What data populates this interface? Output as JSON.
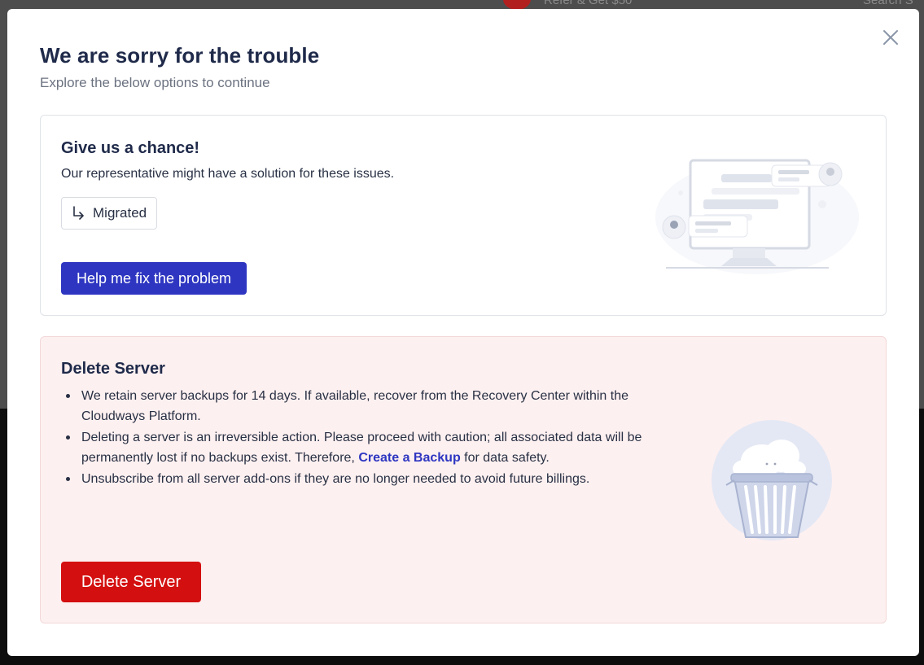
{
  "background": {
    "refer_text": "Refer & Get $50",
    "search_text": "Search S"
  },
  "modal": {
    "title": "We are sorry for the trouble",
    "subtitle": "Explore the below options to continue",
    "close_icon": "close-icon"
  },
  "chance_card": {
    "title": "Give us a chance!",
    "text": "Our representative might have a solution for these issues.",
    "chip_label": "Migrated",
    "chip_icon": "arrow-turn-down-right-icon",
    "help_button": "Help me fix the problem",
    "illustration": "support-chat-monitor-illustration"
  },
  "delete_card": {
    "title": "Delete Server",
    "bullets": {
      "b1": "We retain server backups for 14 days. If available, recover from the Recovery Center within the Cloudways Platform.",
      "b2_before": "Deleting a server is an irreversible action. Please proceed with caution; all associated data will be permanently lost if no backups exist. Therefore, ",
      "b2_link": "Create a Backup",
      "b2_after": " for data safety.",
      "b3": "Unsubscribe from all server add-ons if they are no longer needed to avoid future billings."
    },
    "delete_button": "Delete Server",
    "illustration": "trash-bin-illustration"
  },
  "colors": {
    "primary": "#2e36c1",
    "danger": "#d40f0f",
    "heading": "#1f2a4a",
    "delete_card_bg": "#fdf0f0"
  }
}
